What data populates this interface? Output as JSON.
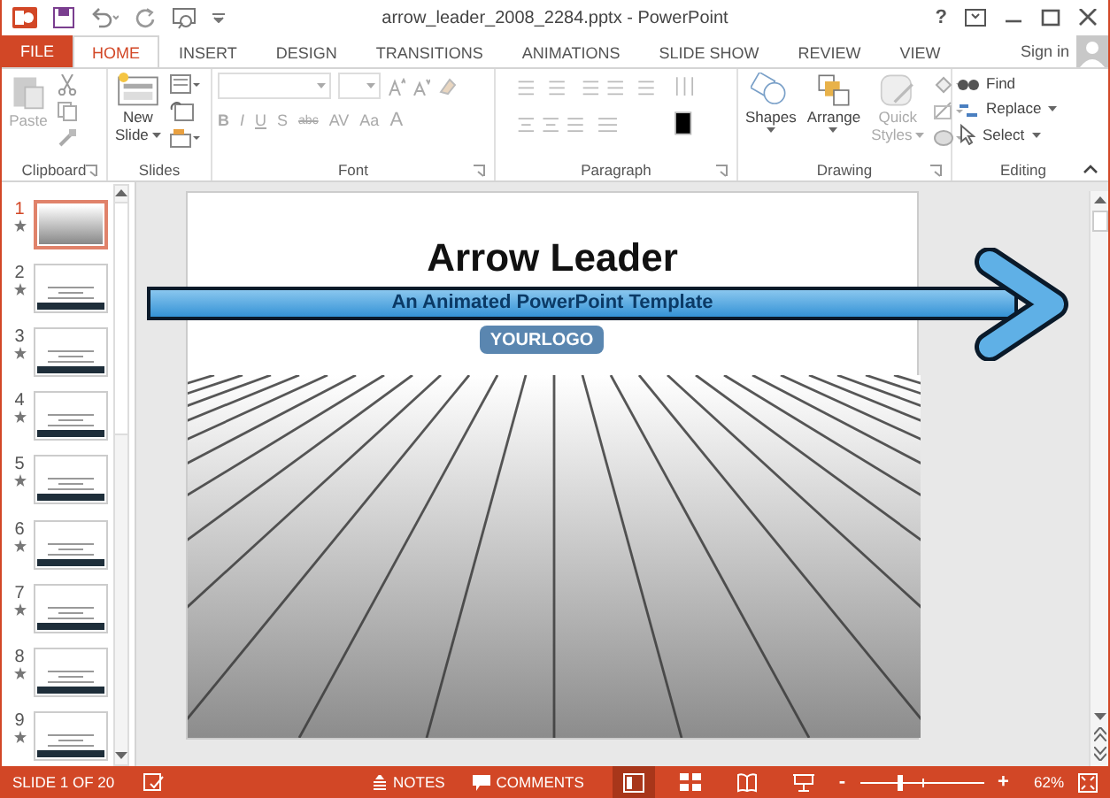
{
  "window": {
    "title": "arrow_leader_2008_2284.pptx - PowerPoint",
    "controls": [
      "?"
    ]
  },
  "tabs": [
    {
      "label": "FILE",
      "kind": "file",
      "selected": false
    },
    {
      "label": "HOME",
      "kind": "tab",
      "selected": true
    },
    {
      "label": "INSERT",
      "kind": "tab",
      "selected": false
    },
    {
      "label": "DESIGN",
      "kind": "tab",
      "selected": false
    },
    {
      "label": "TRANSITIONS",
      "kind": "tab",
      "selected": false
    },
    {
      "label": "ANIMATIONS",
      "kind": "tab",
      "selected": false
    },
    {
      "label": "SLIDE SHOW",
      "kind": "tab",
      "selected": false
    },
    {
      "label": "REVIEW",
      "kind": "tab",
      "selected": false
    },
    {
      "label": "VIEW",
      "kind": "tab",
      "selected": false
    }
  ],
  "sign_in": "Sign in",
  "ribbon": [
    {
      "kind": "clipboard",
      "label": "Clipboard",
      "buttons": [
        "Paste"
      ]
    },
    {
      "kind": "slides",
      "label": "Slides",
      "buttons": [
        "New",
        "Slide"
      ]
    },
    {
      "kind": "font",
      "label": "Font",
      "buttons": [
        "B",
        "I",
        "U",
        "S",
        "abc",
        "AV",
        "Aa",
        "A"
      ]
    },
    {
      "kind": "paragraph",
      "label": "Paragraph"
    },
    {
      "kind": "drawing",
      "label": "Drawing",
      "buttons": [
        "Shapes",
        "Arrange",
        "Quick",
        "Styles"
      ]
    },
    {
      "kind": "editing",
      "label": "Editing",
      "buttons": [
        "Find",
        "Replace",
        "Select"
      ]
    }
  ],
  "thumbnails": [
    {
      "number": "1",
      "selected": true
    },
    {
      "number": "2",
      "selected": false
    },
    {
      "number": "3",
      "selected": false
    },
    {
      "number": "4",
      "selected": false
    },
    {
      "number": "5",
      "selected": false
    },
    {
      "number": "6",
      "selected": false
    },
    {
      "number": "7",
      "selected": false
    },
    {
      "number": "8",
      "selected": false
    },
    {
      "number": "9",
      "selected": false
    }
  ],
  "slide": {
    "title": "Arrow Leader",
    "subtitle": "An Animated PowerPoint Template",
    "logo": "YOURLOGO"
  },
  "status_bar": {
    "slide_info": "SLIDE 1 OF 20",
    "notes": "NOTES",
    "comments": "COMMENTS",
    "views": [
      {
        "kind": "normal",
        "selected": true
      },
      {
        "kind": "sorter",
        "selected": false
      },
      {
        "kind": "reading",
        "selected": false
      },
      {
        "kind": "slideshow",
        "selected": false
      }
    ],
    "zoom": {
      "minus": "-",
      "plus": "+",
      "level": 0.3,
      "reading": "62%"
    }
  }
}
